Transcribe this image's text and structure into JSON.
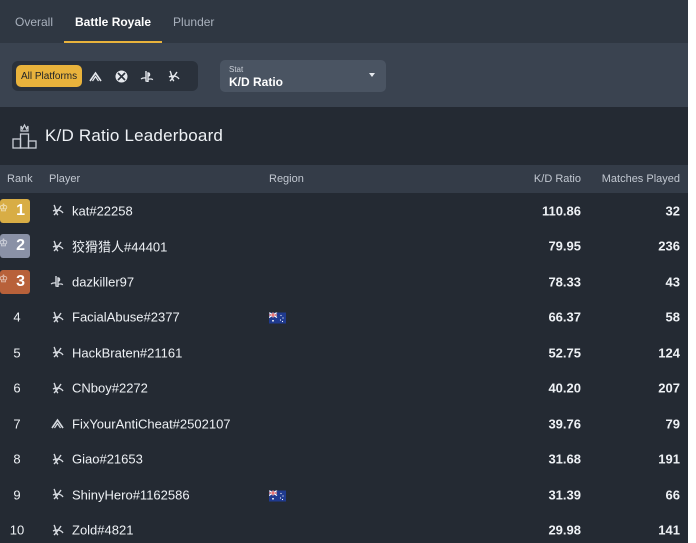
{
  "tabs": [
    {
      "label": "Overall",
      "active": false
    },
    {
      "label": "Battle Royale",
      "active": true
    },
    {
      "label": "Plunder",
      "active": false
    }
  ],
  "filters": {
    "all_platforms": "All Platforms",
    "platform_icons": [
      "activision-icon",
      "xbox-icon",
      "playstation-icon",
      "battlenet-icon"
    ],
    "stat_label": "Stat",
    "stat_value": "K/D Ratio"
  },
  "leaderboard": {
    "title": "K/D Ratio Leaderboard",
    "headers": {
      "rank": "Rank",
      "player": "Player",
      "region": "Region",
      "kd": "K/D Ratio",
      "matches": "Matches Played"
    },
    "rows": [
      {
        "rank": "1",
        "platform": "battlenet",
        "player": "kat#22258",
        "region": "",
        "kd": "110.86",
        "matches": "32"
      },
      {
        "rank": "2",
        "platform": "battlenet",
        "player": "狡猾猎人#44401",
        "region": "",
        "kd": "79.95",
        "matches": "236"
      },
      {
        "rank": "3",
        "platform": "playstation",
        "player": "dazkiller97",
        "region": "",
        "kd": "78.33",
        "matches": "43"
      },
      {
        "rank": "4",
        "platform": "battlenet",
        "player": "FacialAbuse#2377",
        "region": "AU",
        "kd": "66.37",
        "matches": "58"
      },
      {
        "rank": "5",
        "platform": "battlenet",
        "player": "HackBraten#21161",
        "region": "",
        "kd": "52.75",
        "matches": "124"
      },
      {
        "rank": "6",
        "platform": "battlenet",
        "player": "CNboy#2272",
        "region": "",
        "kd": "40.20",
        "matches": "207"
      },
      {
        "rank": "7",
        "platform": "activision",
        "player": "FixYourAntiCheat#2502107",
        "region": "",
        "kd": "39.76",
        "matches": "79"
      },
      {
        "rank": "8",
        "platform": "battlenet",
        "player": "Giao#21653",
        "region": "",
        "kd": "31.68",
        "matches": "191"
      },
      {
        "rank": "9",
        "platform": "battlenet",
        "player": "ShinyHero#1162586",
        "region": "AU",
        "kd": "31.39",
        "matches": "66"
      },
      {
        "rank": "10",
        "platform": "battlenet",
        "player": "Zold#4821",
        "region": "",
        "kd": "29.98",
        "matches": "141"
      }
    ]
  },
  "colors": {
    "accent": "#e9b33c",
    "gold": "#d8ad45",
    "silver": "#8a91a6",
    "bronze": "#b8613a"
  }
}
